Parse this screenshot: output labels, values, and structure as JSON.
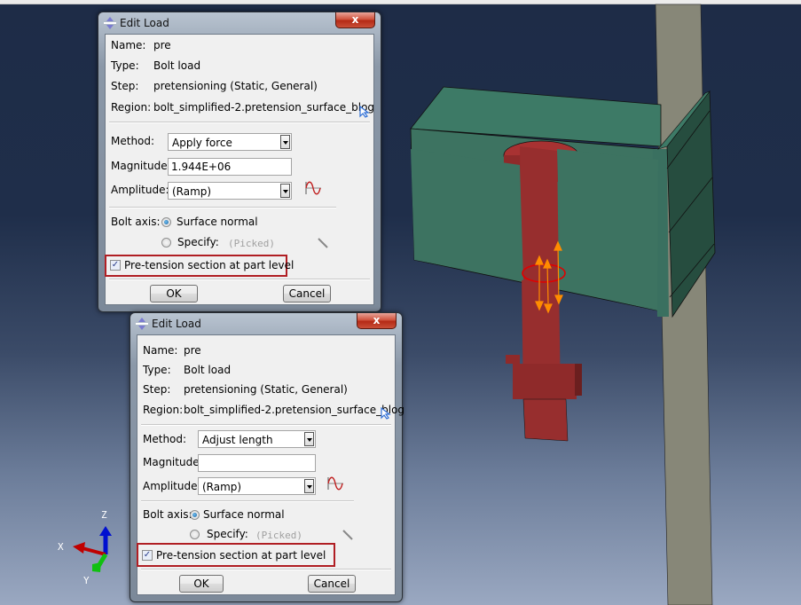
{
  "viewport": {
    "triad": {
      "x_label": "X",
      "y_label": "Y",
      "z_label": "Z"
    },
    "model_colors": {
      "bolt": "#9a2e2e",
      "plate": "#3d7361",
      "plate_side": "#264d3f",
      "column": "#878778",
      "load_arrows": "#ff8c00",
      "section_ring": "#e00000"
    }
  },
  "dialogs": [
    {
      "title": "Edit Load",
      "close_label": "x",
      "name_label": "Name:",
      "name_value": "pre",
      "type_label": "Type:",
      "type_value": "Bolt load",
      "step_label": "Step:",
      "step_value": "pretensioning (Static, General)",
      "region_label": "Region:",
      "region_value": "bolt_simplified-2.pretension_surface_blog",
      "method_label": "Method:",
      "method_value": "Apply force",
      "magnitude_label": "Magnitude:",
      "magnitude_value": "1.944E+06",
      "amplitude_label": "Amplitude:",
      "amplitude_value": "(Ramp)",
      "bolt_axis_label": "Bolt axis:",
      "surface_normal_label": "Surface normal",
      "surface_normal_selected": true,
      "specify_label": "Specify:",
      "specify_value": "(Picked)",
      "pretension_label": "Pre-tension section at part level",
      "pretension_checked": true,
      "ok_label": "OK",
      "cancel_label": "Cancel"
    },
    {
      "title": "Edit Load",
      "close_label": "x",
      "name_label": "Name:",
      "name_value": "pre",
      "type_label": "Type:",
      "type_value": "Bolt load",
      "step_label": "Step:",
      "step_value": "pretensioning (Static, General)",
      "region_label": "Region:",
      "region_value": "bolt_simplified-2.pretension_surface_blog",
      "method_label": "Method:",
      "method_value": "Adjust length",
      "magnitude_label": "Magnitude:",
      "magnitude_value": "",
      "amplitude_label": "Amplitude:",
      "amplitude_value": "(Ramp)",
      "bolt_axis_label": "Bolt axis:",
      "surface_normal_label": "Surface normal",
      "surface_normal_selected": true,
      "specify_label": "Specify:",
      "specify_value": "(Picked)",
      "pretension_label": "Pre-tension section at part level",
      "pretension_checked": true,
      "ok_label": "OK",
      "cancel_label": "Cancel"
    }
  ]
}
